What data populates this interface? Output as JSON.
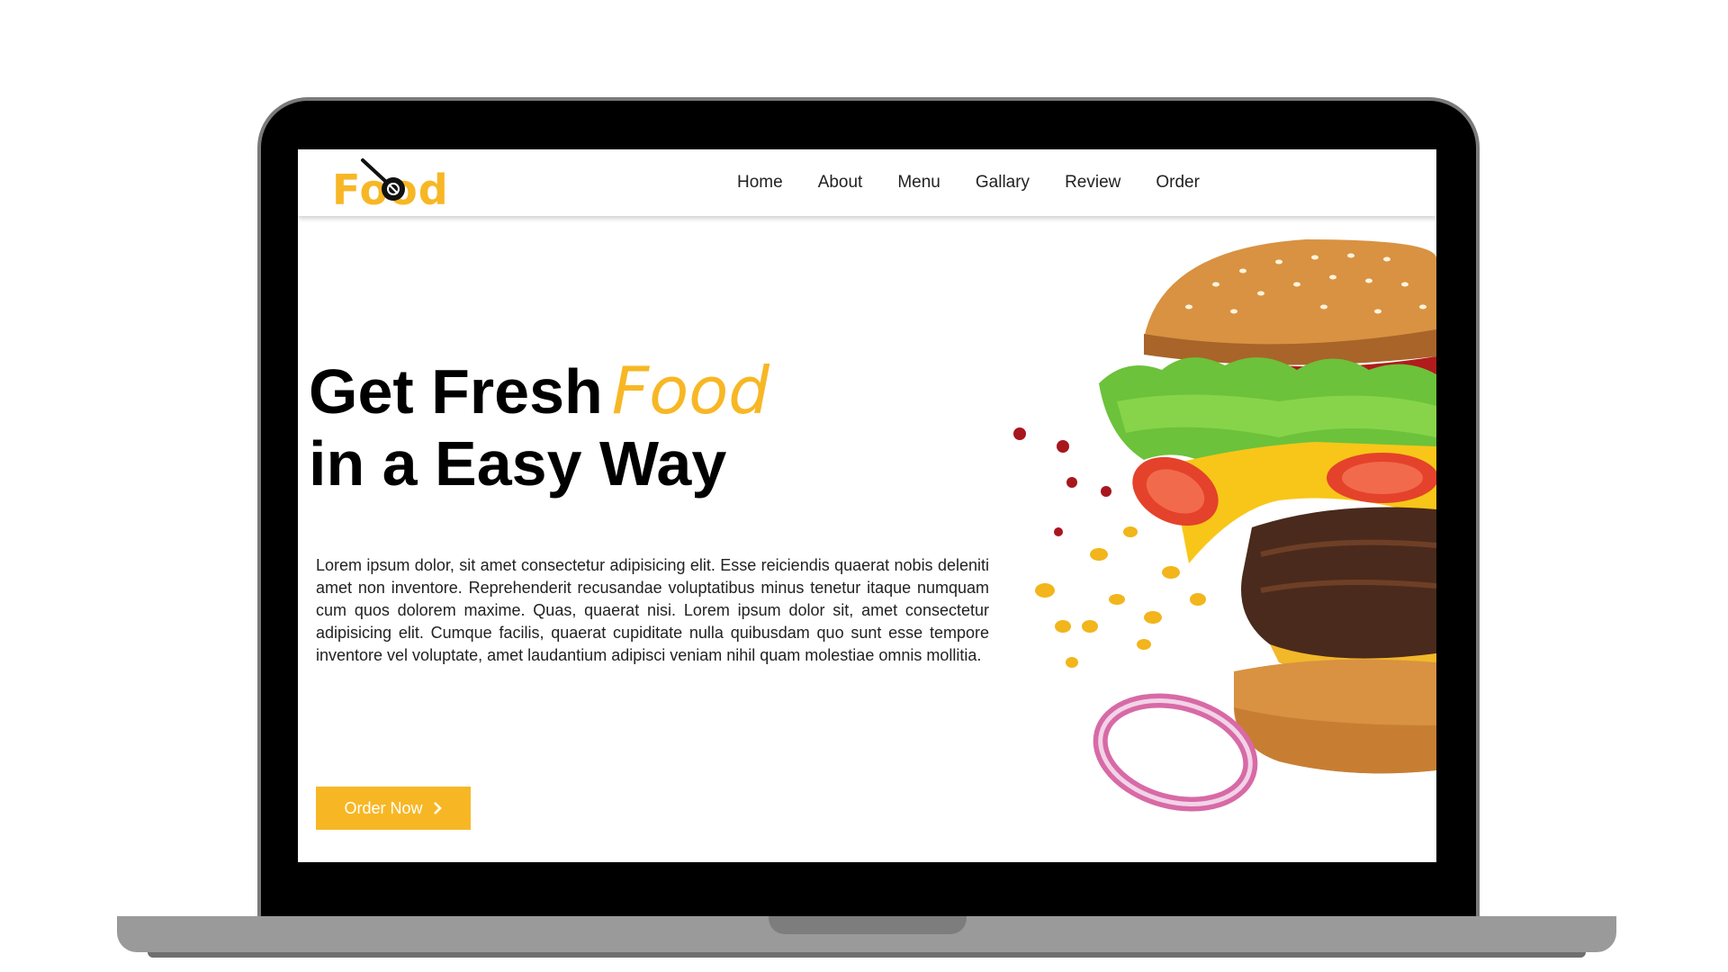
{
  "brand": {
    "name": "Food",
    "accent_color": "#f7b725"
  },
  "nav": {
    "items": [
      {
        "label": "Home"
      },
      {
        "label": "About"
      },
      {
        "label": "Menu"
      },
      {
        "label": "Gallary"
      },
      {
        "label": "Review"
      },
      {
        "label": "Order"
      }
    ]
  },
  "hero": {
    "title_line1": "Get Fresh",
    "title_accent": "Food",
    "title_line2": "in a Easy Way",
    "description": "Lorem ipsum dolor, sit amet consectetur adipisicing elit. Esse reiciendis quaerat nobis deleniti amet non inventore. Reprehenderit recusandae voluptatibus minus tenetur itaque numquam cum quos dolorem maxime. Quas, quaerat nisi. Lorem ipsum dolor sit, amet consectetur adipisicing elit. Cumque facilis, quaerat cupiditate nulla quibusdam quo sunt esse tempore inventore vel voluptate, amet laudantium adipisci veniam nihil quam molestiae omnis mollitia.",
    "cta_label": "Order Now",
    "cta_icon": "chevron-right-icon",
    "image": "burger-image"
  }
}
